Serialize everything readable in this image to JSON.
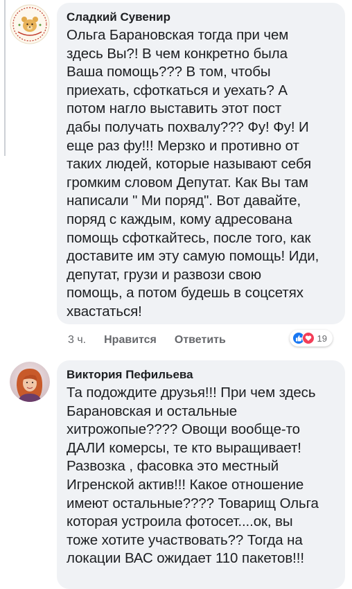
{
  "comments": [
    {
      "author": "Сладкий Сувенир",
      "lines": [
        "Ольга Барановская тогда при чем",
        "здесь Вы?! В чем конкретно была",
        "Ваша помощь??? В том, чтобы",
        "приехать, сфоткаться и уехать? А",
        "потом нагло выставить этот пост",
        "дабы получать похвалу??? Фу! Фу! И",
        "еще раз фу!!! Мерзко и противно от",
        "таких людей, которые называют себя",
        "громким словом Депутат. Как Вы там",
        "написали \" Ми поряд\". Вот давайте,",
        "поряд с каждым, кому адресована",
        "помощь сфоткайтесь, после того, как",
        "доставите им эту самую помощь! Иди,",
        "депутат, грузи и развози свою",
        "помощь, а потом будешь в соцсетях",
        "хвастаться!"
      ],
      "time": "3 ч.",
      "like_label": "Нравится",
      "reply_label": "Ответить",
      "reaction_count": "19",
      "reaction_icons": [
        "like-icon",
        "love-icon"
      ]
    },
    {
      "author": "Виктория Пефильева",
      "lines": [
        "Та подождите друзья!!! При чем здесь",
        "Барановская и остальные",
        "хитрожопые???? Овощи вообще-то",
        "ДАЛИ комерсы, те кто выращивает!",
        "Развозка , фасовка это местный",
        "Игренской актив!!! Какое отношение",
        "имеют остальные???? Товарищ Ольга",
        "которая устроила фотосет....ок, вы",
        "тоже хотите участвовать?? Тогда на",
        "локации ВАС ожидает 110 пакетов!!!"
      ]
    }
  ],
  "colors": {
    "bubble": "#f0f2f5",
    "text": "#1c1e21",
    "meta": "#65676b",
    "like": "#1877f2",
    "love": "#f33e58"
  }
}
